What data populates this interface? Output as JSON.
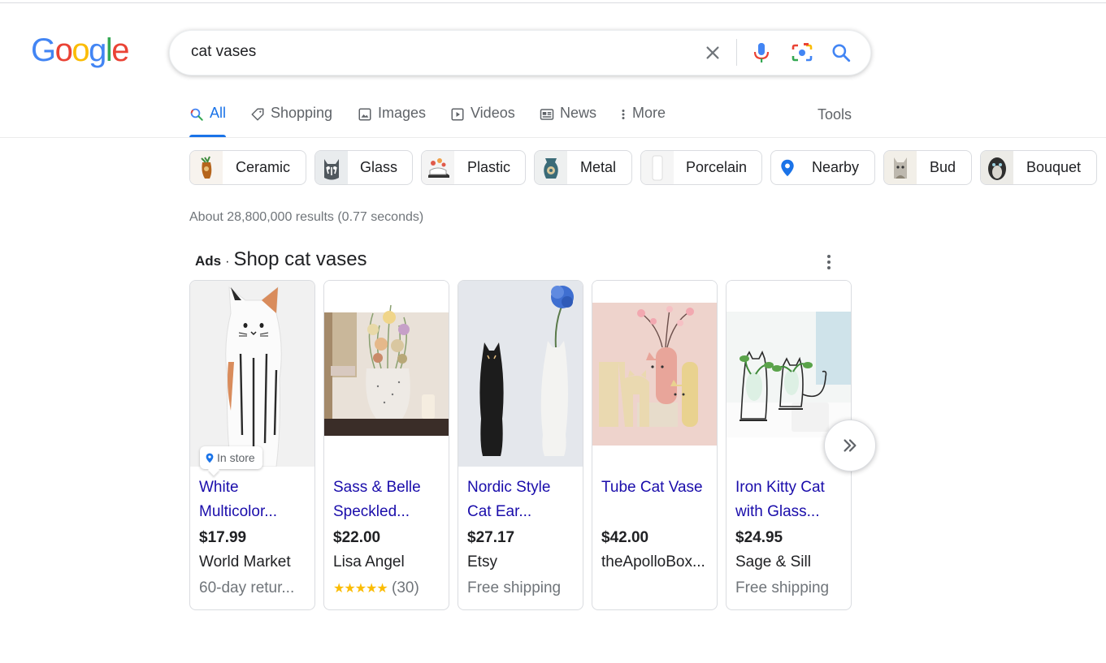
{
  "logo": {
    "letters": [
      "G",
      "o",
      "o",
      "g",
      "l",
      "e"
    ]
  },
  "search": {
    "value": "cat vases"
  },
  "tabs": [
    {
      "label": "All",
      "icon": "search-icon"
    },
    {
      "label": "Shopping",
      "icon": "tag-icon"
    },
    {
      "label": "Images",
      "icon": "image-icon"
    },
    {
      "label": "Videos",
      "icon": "play-icon"
    },
    {
      "label": "News",
      "icon": "news-icon"
    },
    {
      "label": "More",
      "icon": "more-vert-icon"
    }
  ],
  "tools_label": "Tools",
  "chips": [
    {
      "label": "Ceramic"
    },
    {
      "label": "Glass"
    },
    {
      "label": "Plastic"
    },
    {
      "label": "Metal"
    },
    {
      "label": "Porcelain"
    },
    {
      "label": "Nearby",
      "icon": "location-pin-icon"
    },
    {
      "label": "Bud"
    },
    {
      "label": "Bouquet"
    }
  ],
  "result_stats": "About 28,800,000 results (0.77 seconds)",
  "ads": {
    "label": "Ads",
    "separator": "·",
    "title": "Shop cat vases",
    "products": [
      {
        "title": "White Multicolor...",
        "price": "$17.99",
        "merchant": "World Market",
        "extra": "60-day retur...",
        "badge": "In store"
      },
      {
        "title": "Sass & Belle Speckled...",
        "price": "$22.00",
        "merchant": "Lisa Angel",
        "rating_stars": "★★★★★",
        "rating_count": "(30)",
        "rating": 4.5
      },
      {
        "title": "Nordic Style Cat Ear...",
        "price": "$27.17",
        "merchant": "Etsy",
        "extra": "Free shipping"
      },
      {
        "title": "Tube Cat Vase",
        "price": "$42.00",
        "merchant": "theApolloBox..."
      },
      {
        "title": "Iron Kitty Cat with Glass...",
        "price": "$24.95",
        "merchant": "Sage & Sill",
        "extra": "Free shipping"
      }
    ]
  },
  "colors": {
    "blue": "#4285f4",
    "red": "#ea4335",
    "yellow": "#fbbc05",
    "green": "#34a853",
    "link": "#1a0dab",
    "active_tab": "#1a73e8"
  }
}
